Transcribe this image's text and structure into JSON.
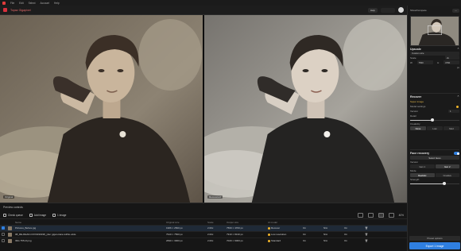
{
  "menu": {
    "items": [
      "File",
      "Edit",
      "Select",
      "Account",
      "Help"
    ]
  },
  "titlebar": {
    "app_name": "Topaz Gigapixel",
    "help_label": "Help"
  },
  "panel_top": {
    "mode_label": "Show/Compare"
  },
  "viewer": {
    "left_caption": "Original",
    "right_caption": "Recovered"
  },
  "bottom": {
    "title": "Preview controls",
    "tools": {
      "check_label": "Check queue",
      "add_label": "Add image",
      "count_label": "1 image"
    },
    "zoom_label": "40%",
    "columns": [
      "",
      "",
      "Name",
      "Original size",
      "Scale",
      "Output size",
      "AI model",
      "",
      "",
      "",
      ""
    ],
    "rows": [
      {
        "name": "Pictures_Before.jpg",
        "orig": "1966 × 2500 px",
        "scale": "2.00x",
        "out": "7560 × 4760 px",
        "model": "Recover",
        "c1": "On",
        "c2": "N/A",
        "c3": "On",
        "selected": true,
        "status_color": "#f0b429"
      },
      {
        "name": "08_RE-READ-COV0190198_yber gigan-tiara-tolitho-wide",
        "orig": "7910 × 7560 px",
        "scale": "2.00x",
        "out": "7910 × 8130 px",
        "model": "Low resolution",
        "c1": "On",
        "c2": "N/A",
        "c3": "On",
        "selected": false,
        "status_color": "#f0b429"
      },
      {
        "name": "IMG 755.tif.png",
        "orig": "2690 × 3000 px",
        "scale": "2.00x",
        "out": "7020 × 6000 px",
        "model": "Standard",
        "c1": "On",
        "c2": "N/A",
        "c3": "On",
        "selected": false,
        "status_color": "#f0b429"
      }
    ]
  },
  "panel": {
    "upscale": {
      "title": "Upscale",
      "preset": "Custom size",
      "scale_label": "Scale",
      "scale": "2x",
      "width_label": "W",
      "width": "7560",
      "height_label": "H",
      "height": "4760",
      "unit": "px"
    },
    "recover": {
      "title": "Recover",
      "model_label": "Super image",
      "model_settings": "Model settings",
      "version_label": "Version",
      "version": "1",
      "detail_label": "Detail",
      "detail_level": 0.45,
      "creativity_label": "Creativity",
      "creativity": [
        "None",
        "Low",
        "Med"
      ],
      "creativity_active": 0,
      "face_label": "Face Recovery"
    },
    "face": {
      "title": "Face recovery",
      "select_faces": "Select faces",
      "version_label": "Version",
      "versions": [
        "Gen 1",
        "Gen 2"
      ],
      "version_active": 1,
      "mode_label": "Mode",
      "modes": [
        "Realistic",
        "Creative"
      ],
      "mode_active": 0,
      "strength_label": "Strength",
      "strength_level": 0.7
    },
    "preset_btn": "Preset options",
    "export_btn": "Export 1 image"
  }
}
